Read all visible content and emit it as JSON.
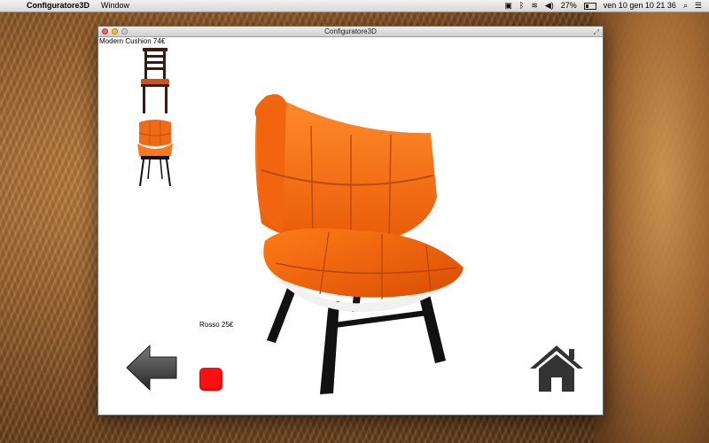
{
  "menubar": {
    "app_name": "Configuratore3D",
    "menus": [
      "Window"
    ],
    "status": {
      "battery_percent": "27%",
      "datetime": "ven 10 gen  10 21 36"
    }
  },
  "window": {
    "title": "Configuratore3D"
  },
  "product": {
    "label": "Modern Cushion  74€",
    "color_label": "Rosso  25€",
    "color_hex": "#ff1010",
    "accent_hex": "#ff6a10"
  },
  "icons": {
    "back": "left-arrow-icon",
    "home": "home-icon"
  }
}
